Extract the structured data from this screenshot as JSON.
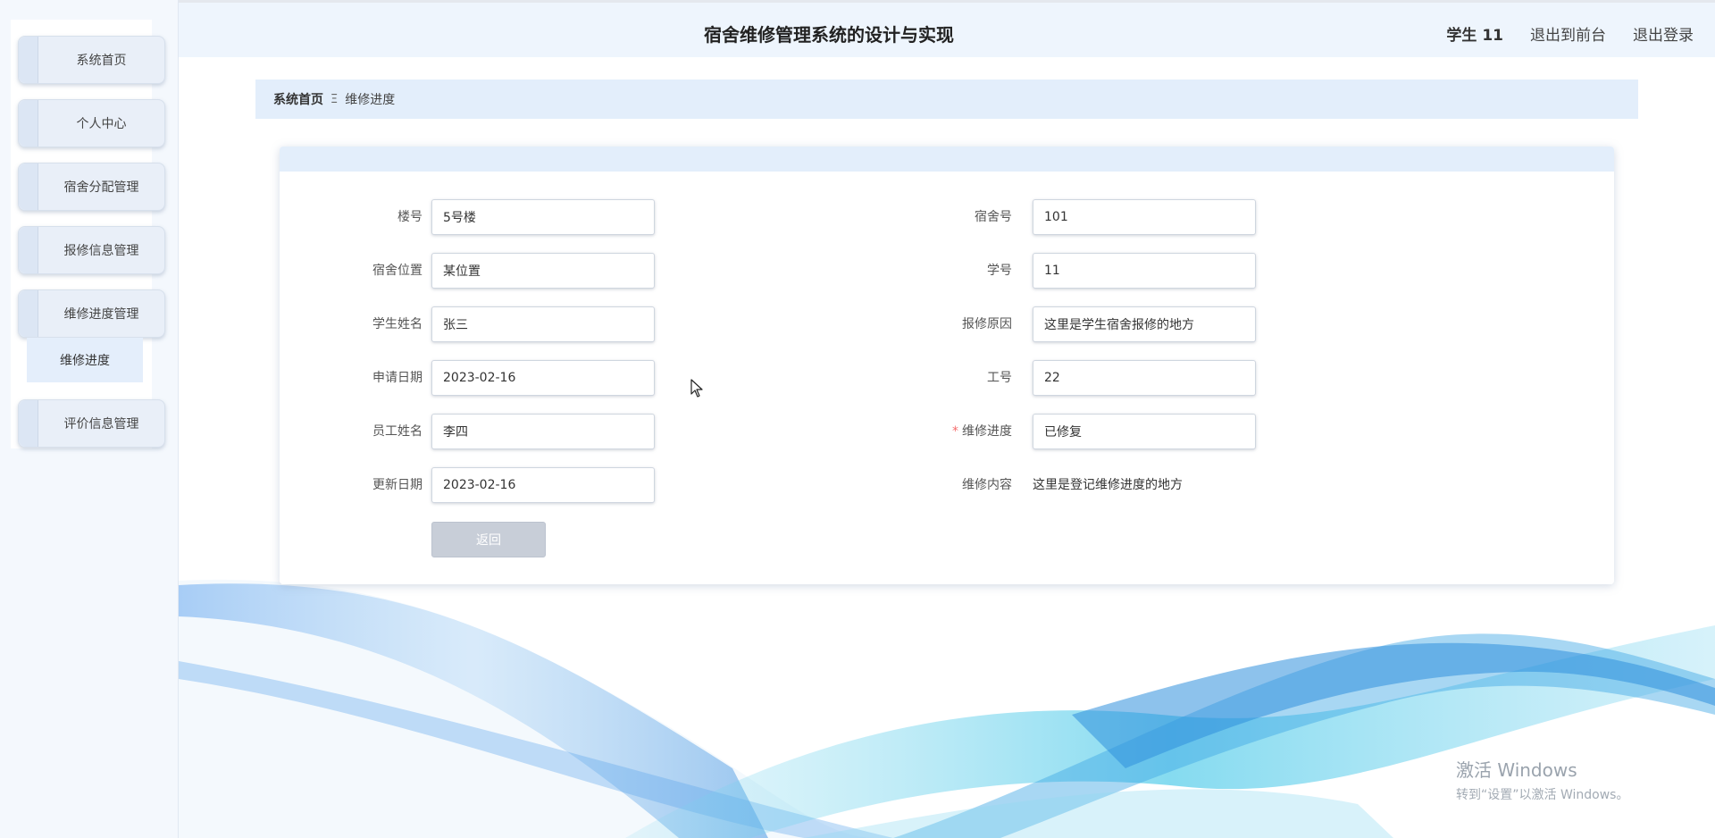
{
  "header": {
    "title": "宿舍维修管理系统的设计与实现",
    "user": "学生 11",
    "front_link": "退出到前台",
    "logout_link": "退出登录"
  },
  "sidebar": {
    "items": [
      {
        "label": "系统首页"
      },
      {
        "label": "个人中心"
      },
      {
        "label": "宿舍分配管理"
      },
      {
        "label": "报修信息管理"
      },
      {
        "label": "维修进度管理"
      },
      {
        "label": "评价信息管理"
      }
    ],
    "submenu": {
      "label": "维修进度"
    }
  },
  "breadcrumb": {
    "home": "系统首页",
    "separator": "Ξ",
    "current": "维修进度"
  },
  "form": {
    "building": {
      "label": "楼号",
      "value": "5号楼"
    },
    "dorm_no": {
      "label": "宿舍号",
      "value": "101"
    },
    "dorm_location": {
      "label": "宿舍位置",
      "value": "某位置"
    },
    "student_no": {
      "label": "学号",
      "value": "11"
    },
    "student_name": {
      "label": "学生姓名",
      "value": "张三"
    },
    "repair_reason": {
      "label": "报修原因",
      "value": "这里是学生宿舍报修的地方"
    },
    "apply_date": {
      "label": "申请日期",
      "value": "2023-02-16"
    },
    "staff_no": {
      "label": "工号",
      "value": "22"
    },
    "staff_name": {
      "label": "员工姓名",
      "value": "李四"
    },
    "repair_progress": {
      "label": "维修进度",
      "required_mark": "*",
      "value": "已修复"
    },
    "update_date": {
      "label": "更新日期",
      "value": "2023-02-16"
    },
    "repair_content": {
      "label": "维修内容",
      "value": "这里是登记维修进度的地方"
    },
    "back_button": "返回"
  },
  "watermark": {
    "title": "激活 Windows",
    "subtitle": "转到“设置”以激活 Windows。"
  },
  "colors": {
    "header_bg": "#eef5fd",
    "breadcrumb_bg": "#e3eefb",
    "sidebar_bg": "#f4f8fd",
    "button_bg": "#c8ced8",
    "required": "#f56c6c",
    "wave_blue": "#3a8fe0",
    "wave_cyan": "#34c3e6"
  }
}
